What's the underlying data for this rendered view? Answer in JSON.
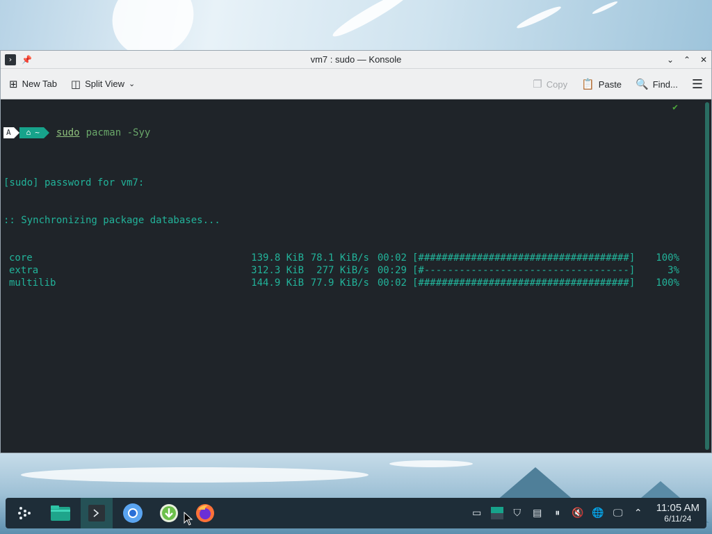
{
  "window": {
    "title": "vm7 : sudo — Konsole"
  },
  "toolbar": {
    "new_tab_label": "New Tab",
    "split_view_label": "Split View",
    "copy_label": "Copy",
    "paste_label": "Paste",
    "find_label": "Find..."
  },
  "prompt": {
    "os_segment": "A",
    "home_segment": "~",
    "command_sudo": "sudo",
    "command_rest": "pacman -Syy",
    "status_check": "✔"
  },
  "output": {
    "line1": "[sudo] password for vm7:",
    "line2": ":: Synchronizing package databases...",
    "rows": [
      {
        "name": "core",
        "size": "139.8 KiB",
        "speed": "78.1 KiB/s",
        "time": "00:02",
        "bar": "[####################################]",
        "pct": "100%"
      },
      {
        "name": "extra",
        "size": "312.3 KiB",
        "speed": "277 KiB/s",
        "time": "00:29",
        "bar": "[#-----------------------------------]",
        "pct": "3%"
      },
      {
        "name": "multilib",
        "size": "144.9 KiB",
        "speed": "77.9 KiB/s",
        "time": "00:02",
        "bar": "[####################################]",
        "pct": "100%"
      }
    ]
  },
  "taskbar": {
    "apps": [
      "application-launcher-icon",
      "file-manager-icon",
      "terminal-icon",
      "chromium-icon",
      "download-manager-icon",
      "firefox-icon"
    ],
    "clock_time": "11:05 AM",
    "clock_date": "6/11/24"
  },
  "colors": {
    "terminal_bg": "#1f2429",
    "terminal_fg": "#22b39a",
    "accent": "#17a38b",
    "taskbar_bg": "#1e2d38"
  }
}
